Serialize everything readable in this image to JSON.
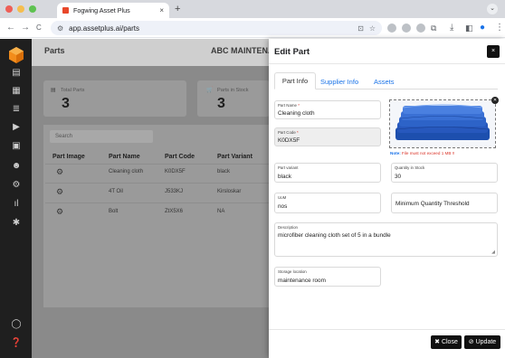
{
  "browser": {
    "tab_title": "Fogwing Asset Plus",
    "tab_close": "×",
    "new_tab": "+",
    "url": "app.assetplus.ai/parts",
    "nav_back": "←",
    "nav_forward": "→",
    "nav_reload": "C"
  },
  "app": {
    "page_title": "Parts",
    "company_name": "ABC MAINTENANC"
  },
  "summary_cards": [
    {
      "label": "Total Parts",
      "value": "3"
    },
    {
      "label": "Parts in Stock",
      "value": "3"
    }
  ],
  "table": {
    "search_placeholder": "Search",
    "headers": [
      "Part Image",
      "Part Name",
      "Part Code",
      "Part Variant"
    ],
    "rows": [
      {
        "name": "Cleaning cloth",
        "code": "K0DX5F",
        "variant": "black"
      },
      {
        "name": "4T Oil",
        "code": "J533KJ",
        "variant": "Kirsloskar"
      },
      {
        "name": "Bolt",
        "code": "ZtX5X6",
        "variant": "NA"
      }
    ]
  },
  "modal": {
    "title": "Edit Part",
    "close_icon": "×",
    "tabs": [
      {
        "label": "Part Info",
        "active": true
      },
      {
        "label": "Supplier Info",
        "active": false
      },
      {
        "label": "Assets",
        "active": false
      }
    ],
    "fields": {
      "part_name": {
        "label": "Part Name",
        "required": "*",
        "value": "Cleaning cloth"
      },
      "part_code": {
        "label": "Part Code",
        "required": "*",
        "value": "K0DX5F"
      },
      "part_variant": {
        "label": "Part variant",
        "value": "black"
      },
      "quantity_in_stock": {
        "label": "Quantity in Stock",
        "value": "30"
      },
      "uom": {
        "label": "UoM",
        "value": "nos"
      },
      "min_qty_threshold": {
        "placeholder": "Minimum Quantity Threshold"
      },
      "description": {
        "label": "Description",
        "value": "microfiber cleaning cloth set of 5 in a bundle"
      },
      "storage_location": {
        "label": "Storage location",
        "value": "maintenance room"
      }
    },
    "image_note_prefix": "Note:",
    "image_note_text": "File must not exceed 1 MB !!",
    "buttons": {
      "close": "✖ Close",
      "update": "⊘ Update"
    }
  },
  "colors": {
    "accent_blue": "#1a73e8",
    "sidebar_bg": "#1f1f1f",
    "logo_orange": "#f28c1b",
    "button_dark": "#111111",
    "error_red": "#d93025",
    "cloth_blue": "#2d63c8"
  }
}
